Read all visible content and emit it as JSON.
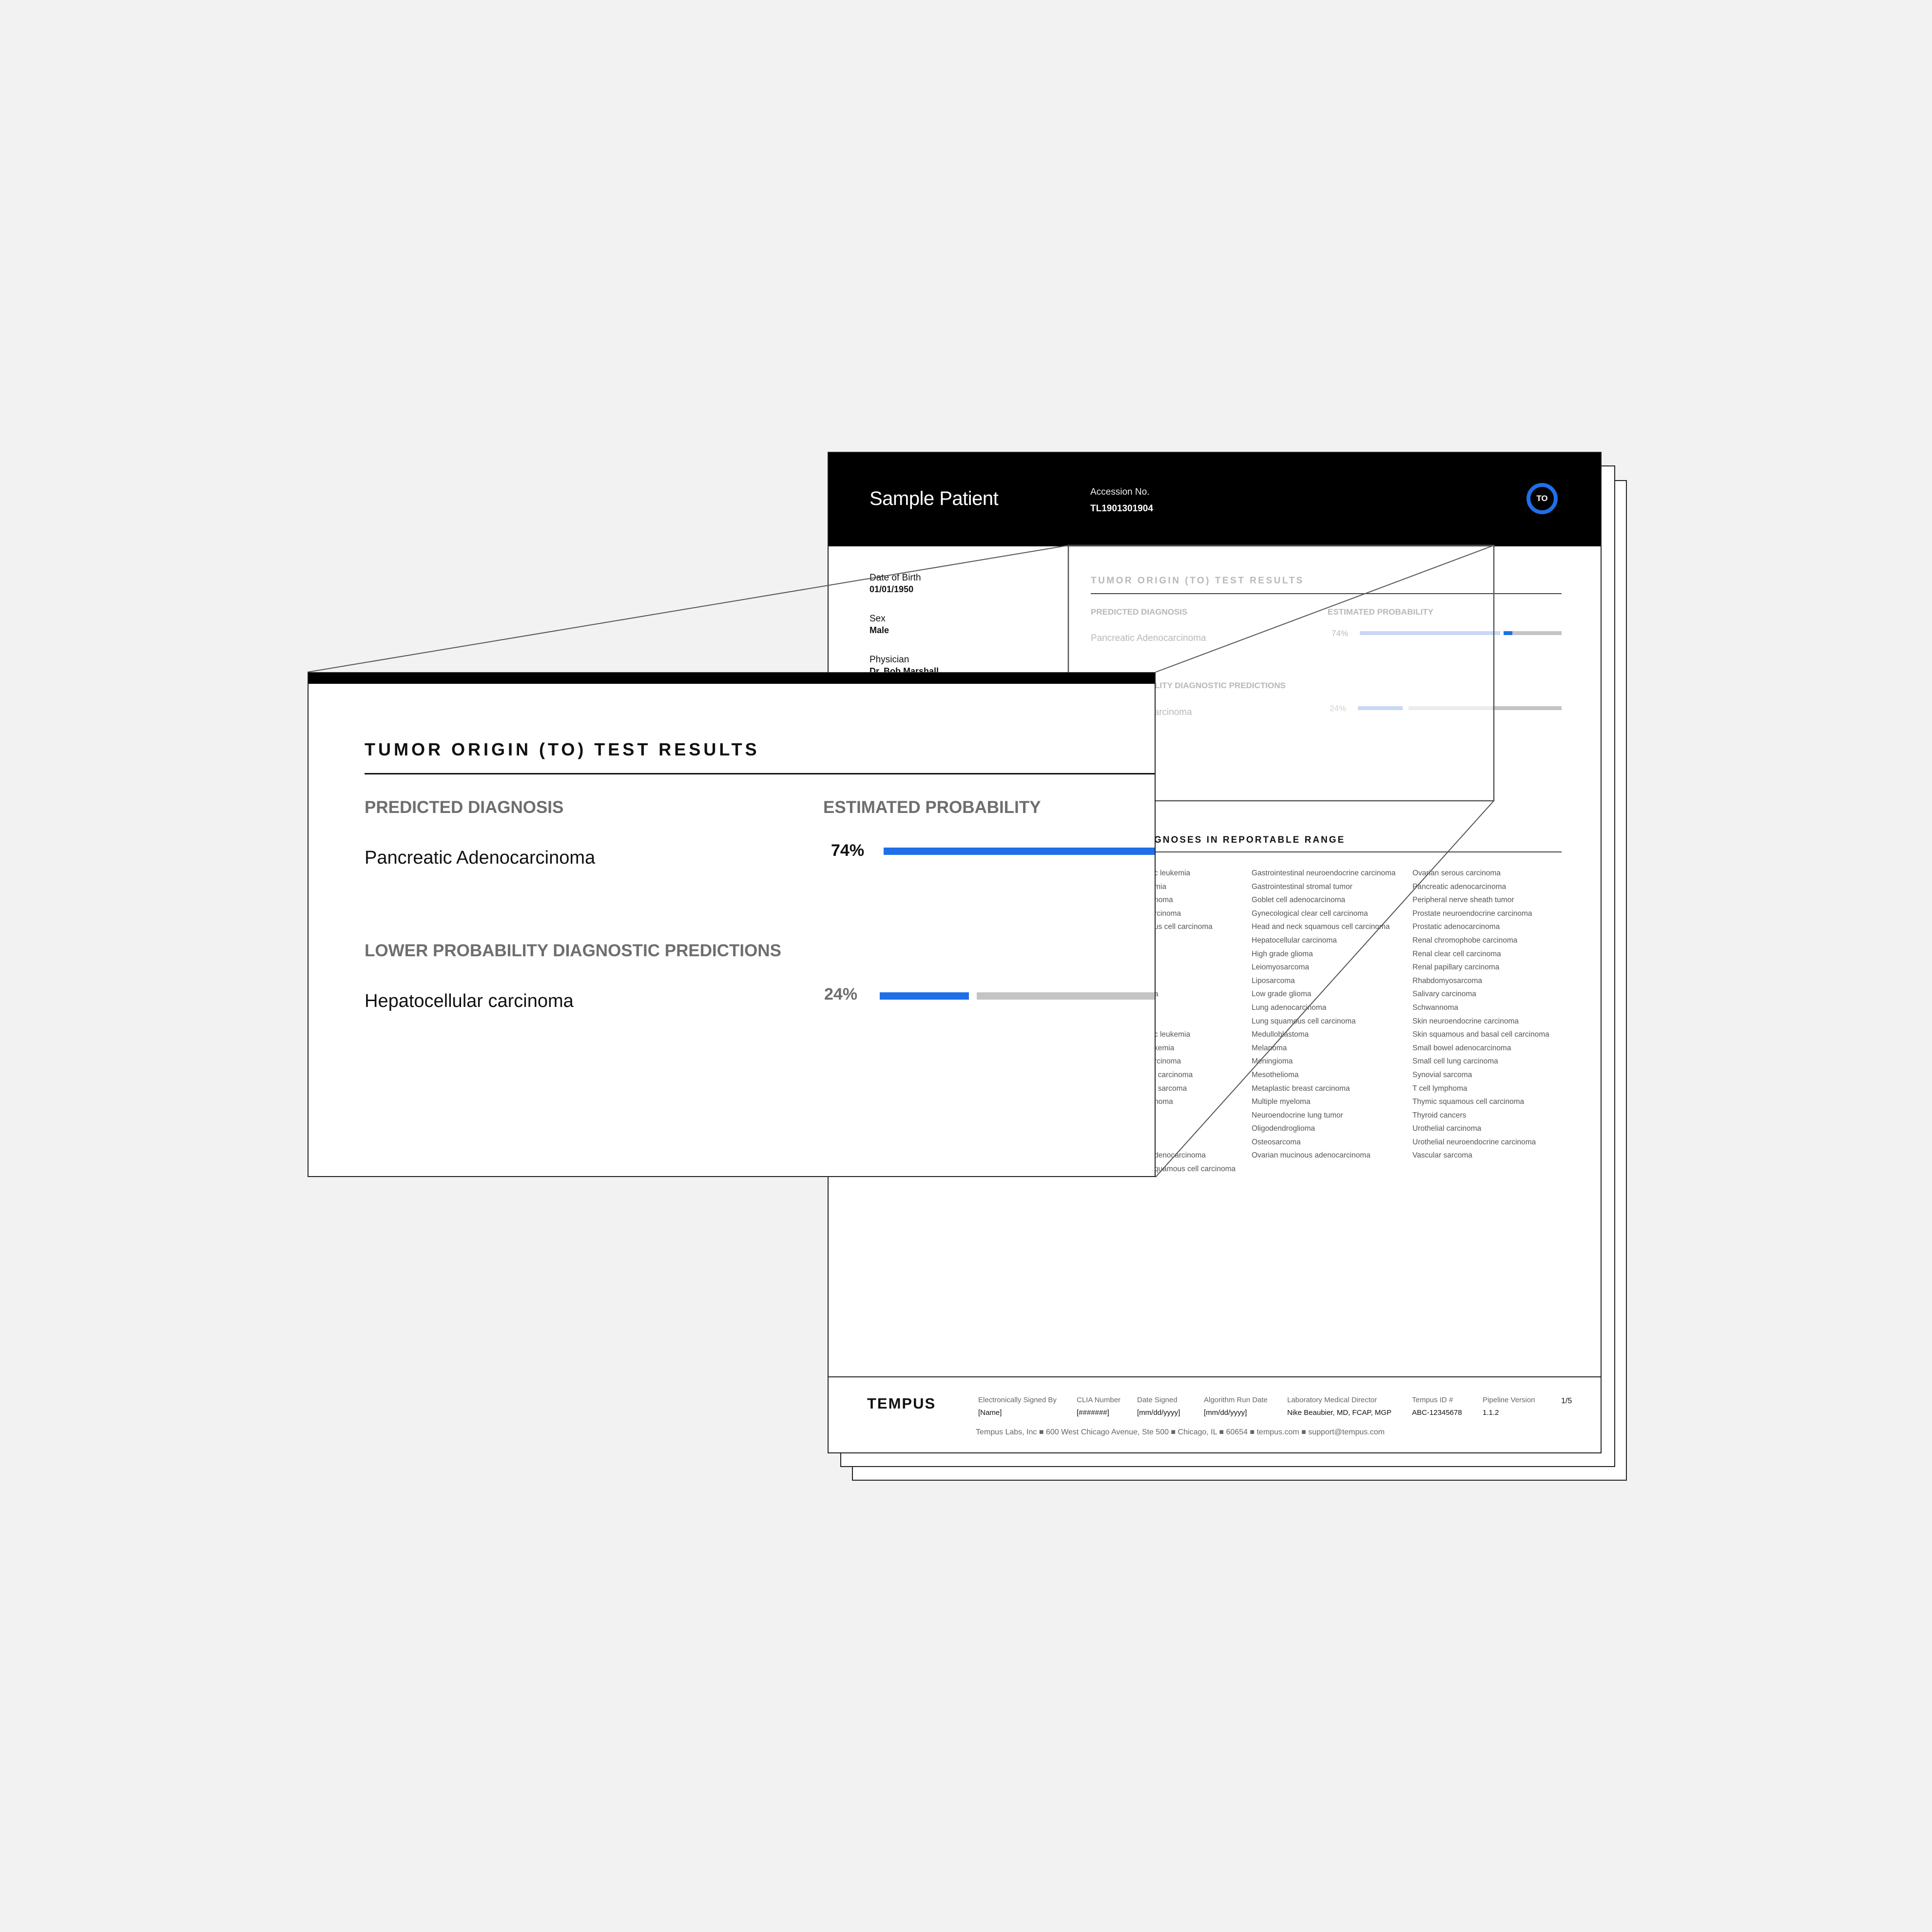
{
  "report": {
    "patient_name": "Sample Patient",
    "accession_label": "Accession No.",
    "accession_value": "TL1901301904",
    "badge": "TO",
    "dob_label": "Date of Birth",
    "dob_value": "01/01/1950",
    "sex_label": "Sex",
    "sex_value": "Male",
    "physician_label": "Physician",
    "physician_value": "Dr. Bob Marshall",
    "results": {
      "title": "TUMOR ORIGIN (TO) TEST RESULTS",
      "predicted_header": "PREDICTED DIAGNOSIS",
      "probability_header": "ESTIMATED PROBABILITY",
      "predicted_diagnosis": "Pancreatic Adenocarcinoma",
      "predicted_pct": "74%",
      "predicted_value": 74,
      "lower_header": "LOWER PROBABILITY DIAGNOSTIC PREDICTIONS",
      "lower_header_partial": "BILITY DIAGNOSTIC PREDICTIONS",
      "lower_diagnosis": "Hepatocellular carcinoma",
      "lower_diagnosis_partial": "carcinoma",
      "lower_pct": "24%",
      "lower_value": 24
    },
    "reportable": {
      "title_partial": "GNOSES IN REPORTABLE RANGE",
      "col1_partial": [
        "c leukemia",
        "mia",
        "noma",
        "rcinoma",
        "us cell carcinoma",
        "",
        "",
        "",
        "",
        "a",
        "",
        "",
        "c leukemia",
        "kemia",
        "rcinoma",
        "l carcinoma",
        "l sarcoma",
        "noma",
        "",
        "",
        "",
        "denocarcinoma",
        "quamous cell carcinoma"
      ],
      "col2": [
        "Gastrointestinal neuroendocrine carcinoma",
        "Gastrointestinal stromal tumor",
        "Goblet cell adenocarcinoma",
        "Gynecological clear cell carcinoma",
        "Head and neck squamous cell carcinoma",
        "Hepatocellular carcinoma",
        "High grade glioma",
        "Leiomyosarcoma",
        "Liposarcoma",
        "Low grade glioma",
        "Lung adenocarcinoma",
        "Lung squamous cell carcinoma",
        "Medulloblastoma",
        "Melanoma",
        "Meningioma",
        "Mesothelioma",
        "Metaplastic breast carcinoma",
        "Multiple myeloma",
        "Neuroendocrine lung tumor",
        "Oligodendroglioma",
        "Osteosarcoma",
        "Ovarian mucinous adenocarcinoma"
      ],
      "col3": [
        "Ovarian serous carcinoma",
        "Pancreatic adenocarcinoma",
        "Peripheral nerve sheath tumor",
        "Prostate neuroendocrine carcinoma",
        "Prostatic adenocarcinoma",
        "Renal chromophobe carcinoma",
        "Renal clear cell carcinoma",
        "Renal papillary carcinoma",
        "Rhabdomyosarcoma",
        "Salivary carcinoma",
        "Schwannoma",
        "Skin neuroendocrine carcinoma",
        "Skin squamous and basal cell carcinoma",
        "Small bowel adenocarcinoma",
        "Small cell lung carcinoma",
        "Synovial sarcoma",
        "T cell lymphoma",
        "Thymic squamous cell carcinoma",
        "Thyroid cancers",
        "Urothelial carcinoma",
        "Urothelial neuroendocrine carcinoma",
        "Vascular sarcoma"
      ]
    },
    "footer": {
      "logo": "TEMPUS",
      "signed_by_label": "Electronically Signed By",
      "signed_by_value": "[Name]",
      "clia_label": "CLIA Number",
      "clia_value": "[#######]",
      "date_signed_label": "Date Signed",
      "date_signed_value": "[mm/dd/yyyy]",
      "run_date_label": "Algorithm Run Date",
      "run_date_value": "[mm/dd/yyyy]",
      "director_label": "Laboratory Medical Director",
      "director_value": "Nike Beaubier, MD, FCAP, MGP",
      "tempus_id_label": "Tempus ID #",
      "tempus_id_value": "ABC-12345678",
      "pipeline_label": "Pipeline Version",
      "pipeline_value": "1.1.2",
      "page": "1/5",
      "address": "Tempus Labs, Inc  ■  600 West Chicago Avenue, Ste 500  ■  Chicago, IL  ■  60654  ■  tempus.com  ■  support@tempus.com"
    }
  },
  "colors": {
    "accent_blue": "#1f6fe8",
    "faded_blue": "#c9d8f3",
    "bar_gray": "#c4c4c4",
    "header_black": "#000000",
    "background": "#f2f2f2"
  }
}
